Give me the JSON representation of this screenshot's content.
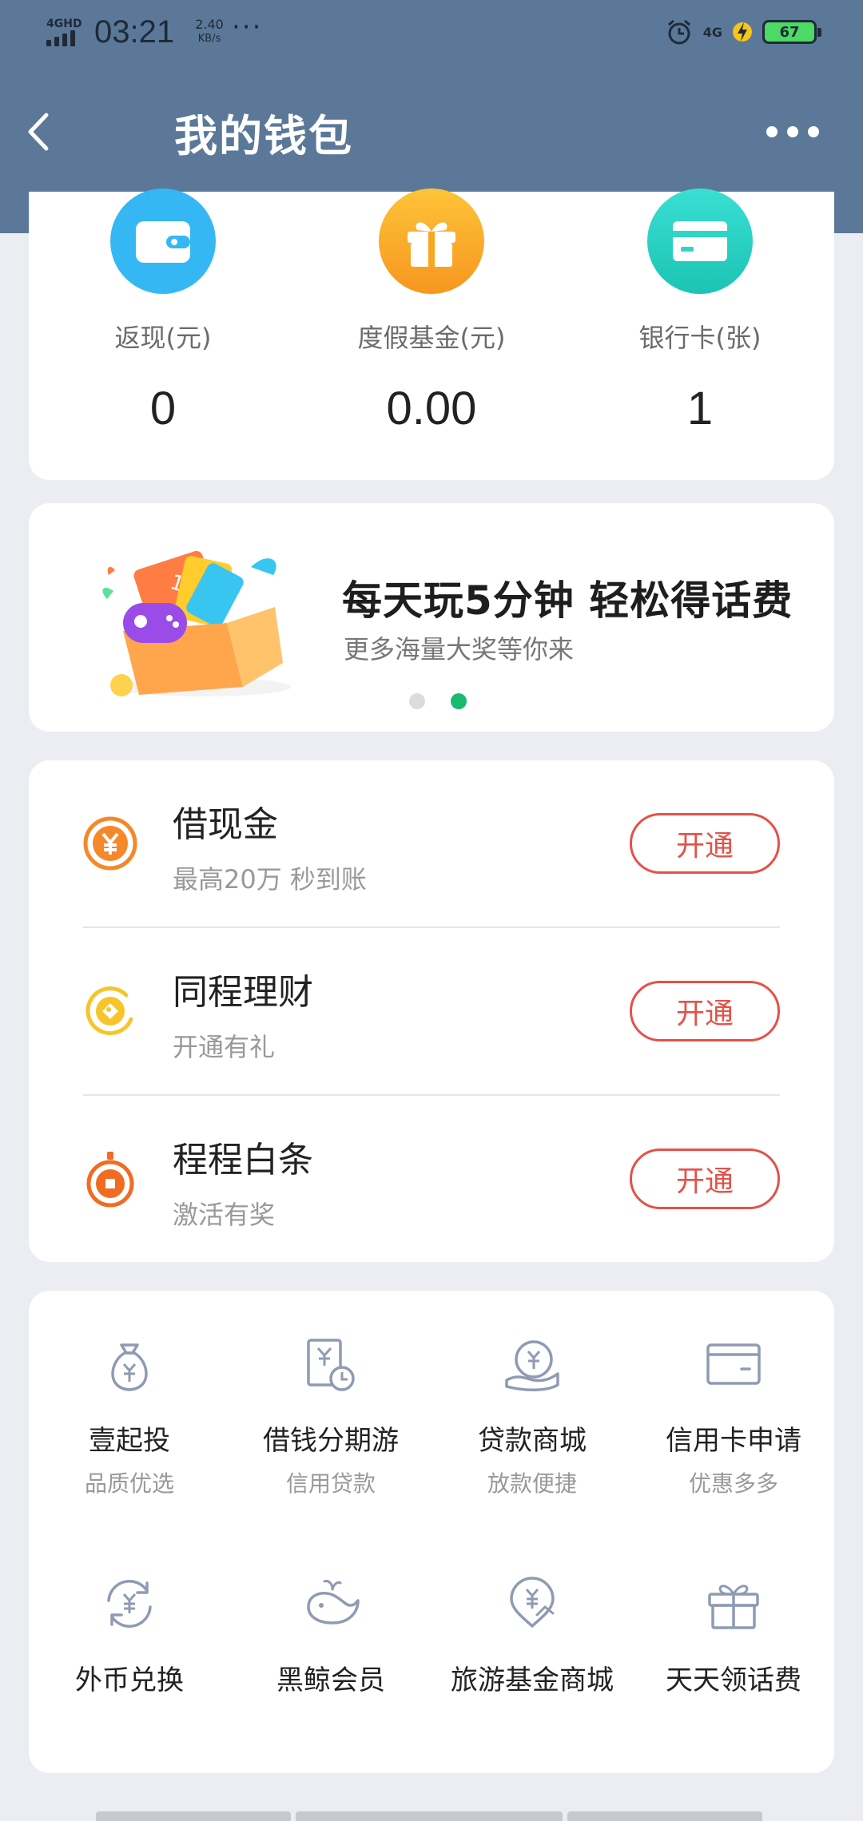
{
  "status_bar": {
    "network": "4GHD",
    "time": "03:21",
    "speed_value": "2.40",
    "speed_unit": "KB/s",
    "more": "···",
    "network_right": "4G",
    "battery": "67"
  },
  "header": {
    "title": "我的钱包",
    "back_icon": "chevron-left-icon",
    "more_icon": "more-dots-icon",
    "color": "#5b7899"
  },
  "summary": [
    {
      "label": "返现(元)",
      "value": "0",
      "icon": "wallet-icon",
      "color": "#35b7f4"
    },
    {
      "label": "度假基金(元)",
      "value": "0.00",
      "icon": "gift-icon",
      "color": "#fbb12c"
    },
    {
      "label": "银行卡(张)",
      "value": "1",
      "icon": "card-icon",
      "color": "#2ed6c6"
    }
  ],
  "banner": {
    "title": "每天玩5分钟  轻松得话费",
    "subtitle": "更多海量大奖等你来",
    "illustration_text": "100",
    "slides": 2,
    "active_slide": 2
  },
  "services": [
    {
      "title": "借现金",
      "subtitle": "最高20万 秒到账",
      "button": "开通",
      "icon": "yuan-coin-icon"
    },
    {
      "title": "同程理财",
      "subtitle": "开通有礼",
      "button": "开通",
      "icon": "finance-coin-icon"
    },
    {
      "title": "程程白条",
      "subtitle": "激活有奖",
      "button": "开通",
      "icon": "white-strip-icon"
    }
  ],
  "grid": [
    {
      "title": "壹起投",
      "subtitle": "品质优选",
      "icon": "money-bag-icon"
    },
    {
      "title": "借钱分期游",
      "subtitle": "信用贷款",
      "icon": "installment-icon"
    },
    {
      "title": "贷款商城",
      "subtitle": "放款便捷",
      "icon": "loan-hand-icon"
    },
    {
      "title": "信用卡申请",
      "subtitle": "优惠多多",
      "icon": "credit-card-icon"
    },
    {
      "title": "外币兑换",
      "subtitle": "",
      "icon": "currency-exchange-icon"
    },
    {
      "title": "黑鲸会员",
      "subtitle": "",
      "icon": "whale-icon"
    },
    {
      "title": "旅游基金商城",
      "subtitle": "",
      "icon": "travel-fund-icon"
    },
    {
      "title": "天天领话费",
      "subtitle": "",
      "icon": "gift-box-icon"
    }
  ],
  "colors": {
    "accent_red": "#e55148",
    "dot_active": "#19b96e",
    "icon_gray": "#8f9bb3"
  }
}
